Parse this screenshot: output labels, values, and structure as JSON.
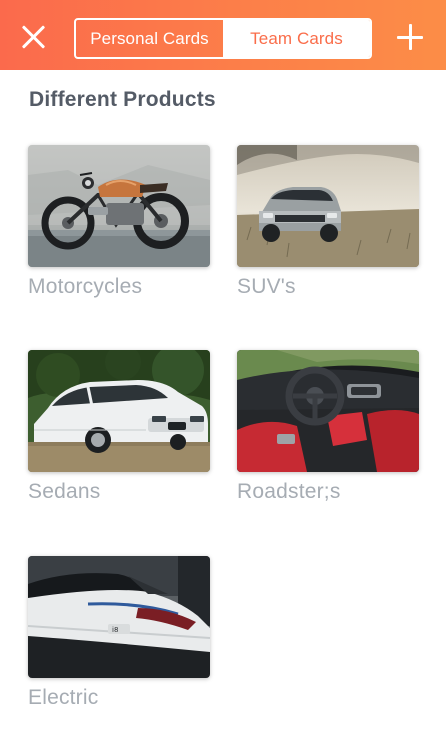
{
  "header": {
    "close_icon": "close-icon",
    "add_icon": "plus-icon",
    "tabs": [
      {
        "label": "Personal Cards",
        "selected": true
      },
      {
        "label": "Team Cards",
        "selected": false
      }
    ],
    "colors": {
      "gradient_start": "#fb6a4c",
      "gradient_end": "#fc8d47"
    }
  },
  "section": {
    "title": "Different Products"
  },
  "products": [
    {
      "label": "Motorcycles",
      "image": "motorcycle-photo"
    },
    {
      "label": "SUV's",
      "image": "suv-photo"
    },
    {
      "label": "Sedans",
      "image": "sedan-photo"
    },
    {
      "label": "Roadster;s",
      "image": "roadster-interior-photo"
    },
    {
      "label": "Electric",
      "image": "electric-car-photo"
    }
  ]
}
